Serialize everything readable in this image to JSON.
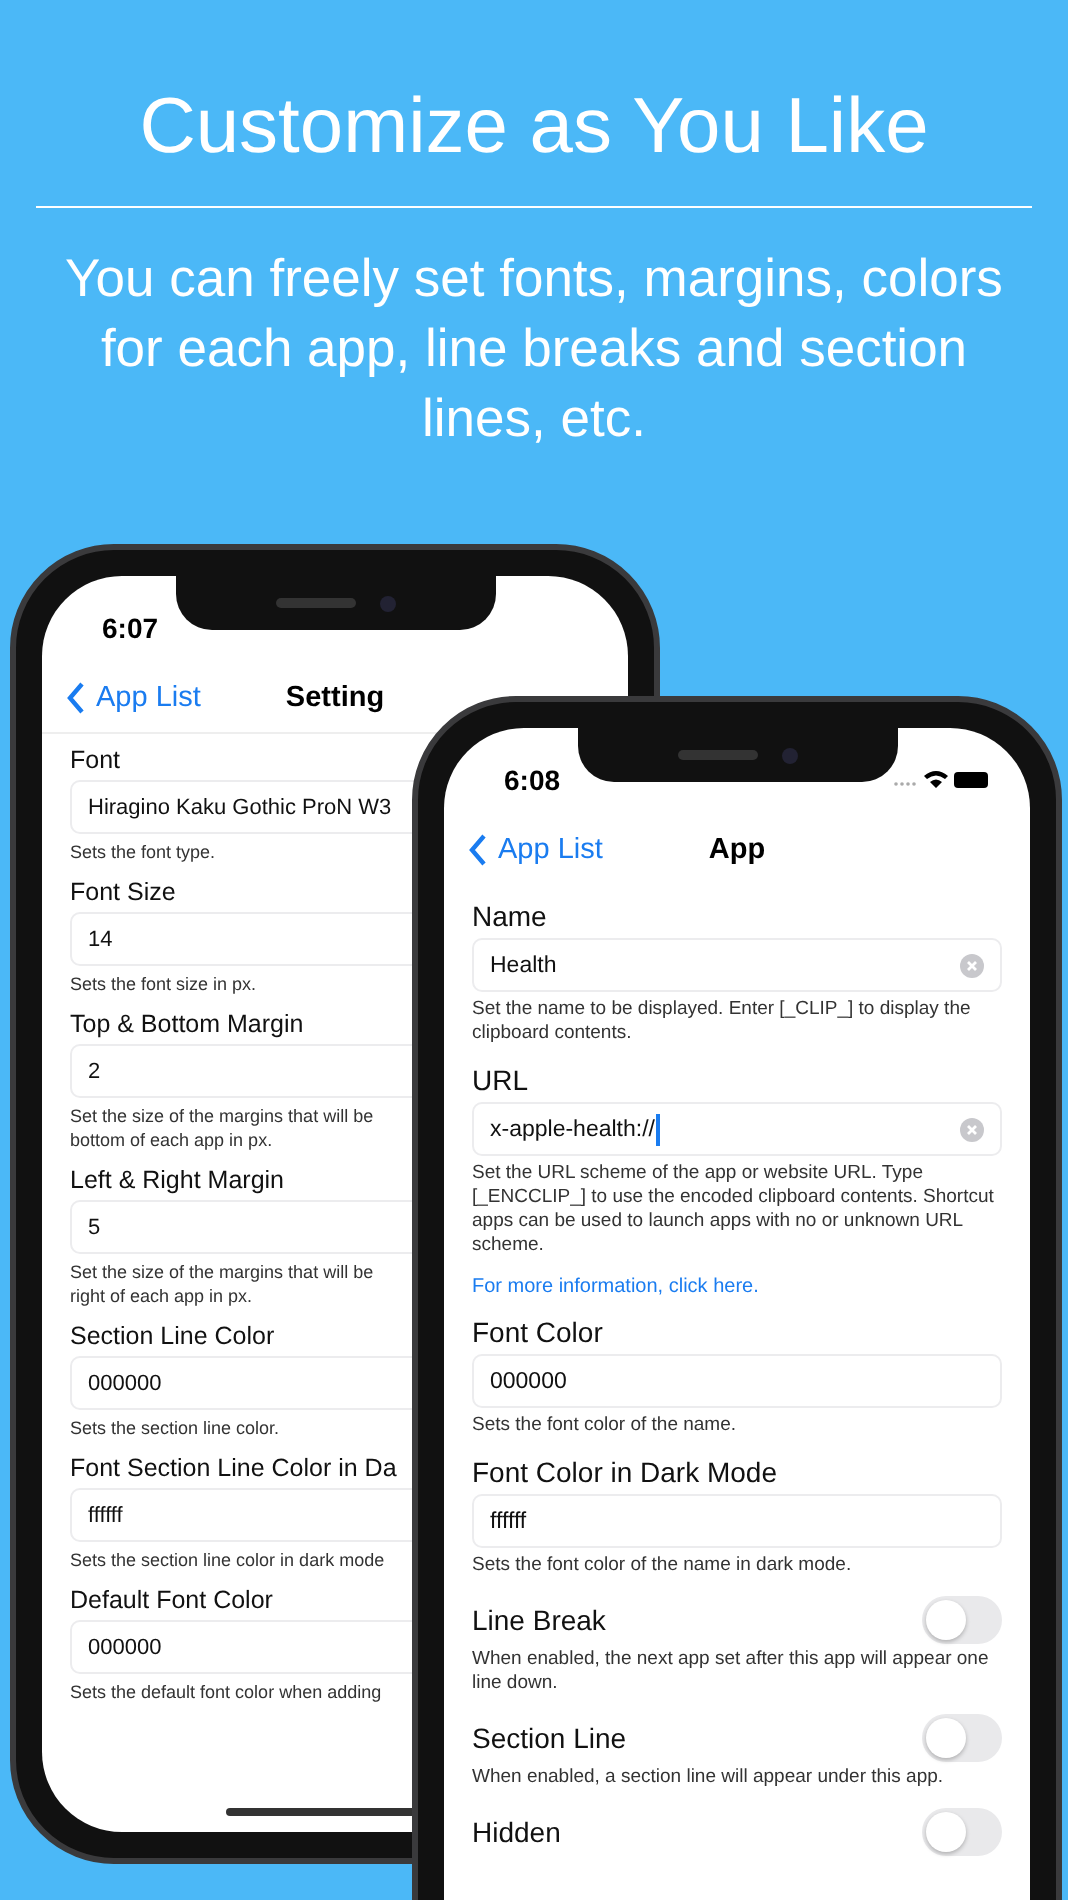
{
  "headline": "Customize as You Like",
  "subtitle": "You can freely set fonts, margins, colors for each app, line breaks and section lines, etc.",
  "phones": [
    {
      "time": "6:07",
      "back_label": "App List",
      "title": "Setting",
      "rows": [
        {
          "kind": "field",
          "label": "Font",
          "value": "Hiragino Kaku Gothic ProN W3",
          "help_lines": [
            "Sets the font type."
          ]
        },
        {
          "kind": "field",
          "label": "Font Size",
          "value": "14",
          "help_lines": [
            "Sets the font size in px."
          ]
        },
        {
          "kind": "field",
          "label": "Top & Bottom Margin",
          "value": "2",
          "help_lines": [
            "Set the size of the margins that will be",
            "bottom of each app in px."
          ]
        },
        {
          "kind": "field",
          "label": "Left & Right Margin",
          "value": "5",
          "help_lines": [
            "Set the size of the margins that will be",
            "right of each app in px."
          ]
        },
        {
          "kind": "field",
          "label": "Section Line Color",
          "value": "000000",
          "help_lines": [
            "Sets the section line color."
          ]
        },
        {
          "kind": "field",
          "label": "Font Section Line Color in Da",
          "value": "ffffff",
          "help_lines": [
            "Sets the section line color in dark mode"
          ]
        },
        {
          "kind": "field",
          "label": "Default Font Color",
          "value": "000000",
          "help_lines": [
            "Sets the default font color when adding"
          ]
        }
      ]
    },
    {
      "time": "6:08",
      "back_label": "App List",
      "title": "App",
      "rows": [
        {
          "kind": "field",
          "label": "Name",
          "value": "Health",
          "clearable": true,
          "help_lines": [
            "Set the name to be displayed. Enter [_CLIP_] to display the clipboard contents."
          ]
        },
        {
          "kind": "field",
          "label": "URL",
          "value": "x-apple-health://",
          "clearable": true,
          "focused": true,
          "help_lines": [
            "Set the URL scheme of the app or website URL. Type [_ENCCLIP_] to use the encoded clipboard contents. Shortcut apps can be used to launch apps with no or unknown URL scheme."
          ]
        },
        {
          "kind": "link",
          "text": "For more information, click here."
        },
        {
          "kind": "field",
          "label": "Font Color",
          "value": "000000",
          "help_lines": [
            "Sets the font color of the name."
          ]
        },
        {
          "kind": "field",
          "label": "Font Color in Dark Mode",
          "value": "ffffff",
          "help_lines": [
            "Sets the font color of the name in dark mode."
          ]
        },
        {
          "kind": "toggle",
          "label": "Line Break",
          "on": false,
          "help_lines": [
            "When enabled, the next app set after this app will appear one line down."
          ]
        },
        {
          "kind": "toggle",
          "label": "Section Line",
          "on": false,
          "help_lines": [
            "When enabled, a section line will appear under this app."
          ]
        },
        {
          "kind": "toggle",
          "label": "Hidden",
          "on": false
        }
      ]
    }
  ]
}
